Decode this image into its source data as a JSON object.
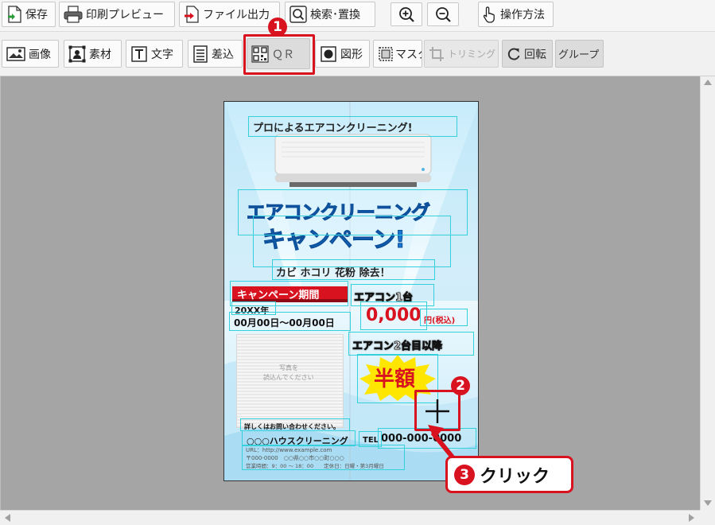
{
  "toolbar_top": {
    "save": "保存",
    "print_preview": "印刷プレビュー",
    "file_output": "ファイル出力",
    "search_replace": "検索･置換",
    "how_to": "操作方法"
  },
  "toolbar_tools": {
    "image": "画像",
    "material": "素材",
    "text": "文字",
    "merge": "差込",
    "qr": "ＱＲ",
    "shape": "図形",
    "mask": "マスク",
    "trimming": "トリミング",
    "rotate": "回転",
    "group": "グループ"
  },
  "flyer": {
    "headline": "プロによるエアコンクリーニング!",
    "title_line1": "エアコンクリーニング",
    "title_line2": "キャンペーン!",
    "subtitle": "カビ ホコリ 花粉 除去！",
    "period_label": "キャンペーン期間",
    "year": "20XX年",
    "dates": "00月00日～00月00日",
    "price_label1": "エアコン1台",
    "price_value": "0,000",
    "price_unit": "円(税込)",
    "price_label2": "エアコン2台目以降",
    "half": "半額",
    "photo_placeholder_line1": "写真を",
    "photo_placeholder_line2": "読込んでください",
    "contact_heading": "詳しくはお問い合わせください。",
    "company": "○○○ハウスクリーニング",
    "tel_label": "TEL",
    "tel_number": "000-000-0000",
    "url": "URL：http://www.example.com",
    "address": "〒000-0000　○○県○○市○○町○○○",
    "hours": "営業時間：9：00 ～ 18：00　　定休日：日曜・第3月曜日"
  },
  "annotations": {
    "step1": "1",
    "step2": "2",
    "step3": "3",
    "click_label": "クリック",
    "accent_color": "#d9121f"
  }
}
